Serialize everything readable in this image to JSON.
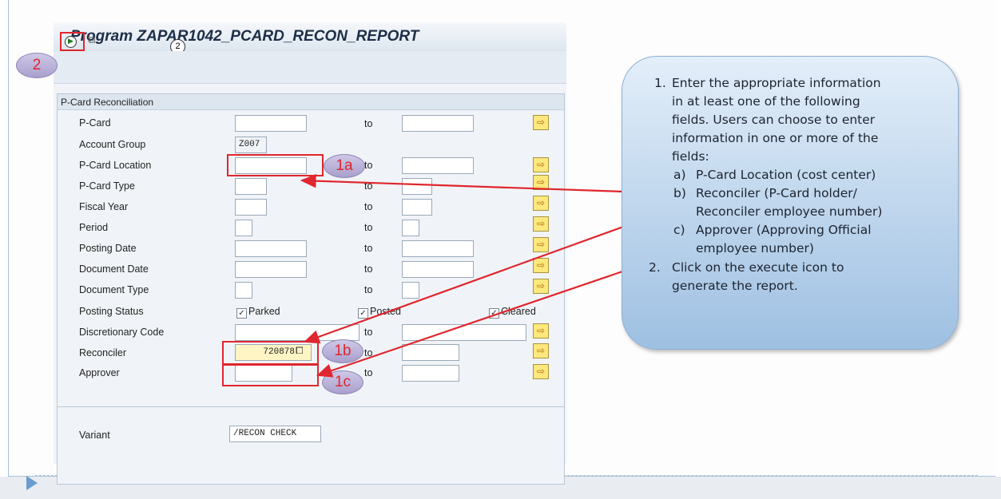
{
  "sap": {
    "title": "Program ZAPAR1042_PCARD_RECON_REPORT",
    "title_marker": "2",
    "group_title": "P-Card Reconciliation",
    "to_label": "to",
    "fields": [
      {
        "label": "P-Card",
        "value": ""
      },
      {
        "label": "Account Group",
        "value": "Z007"
      },
      {
        "label": "P-Card Location",
        "value": ""
      },
      {
        "label": "P-Card Type",
        "value": ""
      },
      {
        "label": "Fiscal Year",
        "value": ""
      },
      {
        "label": "Period",
        "value": ""
      },
      {
        "label": "Posting Date",
        "value": ""
      },
      {
        "label": "Document Date",
        "value": ""
      },
      {
        "label": "Document Type",
        "value": ""
      },
      {
        "label": "Posting Status",
        "value": ""
      },
      {
        "label": "Discretionary Code",
        "value": ""
      },
      {
        "label": "Reconciler",
        "value": "720878"
      },
      {
        "label": "Approver",
        "value": ""
      }
    ],
    "posting_status": [
      "Parked",
      "Posted",
      "Cleared"
    ],
    "variant_label": "Variant",
    "variant_value": "/RECON CHECK"
  },
  "markers": {
    "step2": "2",
    "m1a": "1a",
    "m1b": "1b",
    "m1c": "1c"
  },
  "callout": {
    "item1_num": "1.",
    "item1_lines": [
      "Enter the appropriate information",
      "in at least one of the following",
      "fields. Users can choose to enter",
      "information in one or more of the",
      "fields:"
    ],
    "a_letter": "a)",
    "a_text": "P-Card Location (cost center)",
    "b_letter": "b)",
    "b_lines": [
      "Reconciler (P-Card holder/",
      "Reconciler employee number)"
    ],
    "c_letter": "c)",
    "c_lines": [
      "Approver (Approving Official",
      "employee number)"
    ],
    "item2_num": "2.",
    "item2_lines": [
      "Click on the execute icon to",
      "generate the report."
    ]
  },
  "colors": {
    "annotation_red": "#e0262e",
    "callout_blue": "#9ec0e2",
    "bubble_purple": "#a9a0cd"
  },
  "icons": [
    "execute-icon",
    "multiple-selection-icon",
    "copy-icon",
    "arrow-right-icon"
  ]
}
